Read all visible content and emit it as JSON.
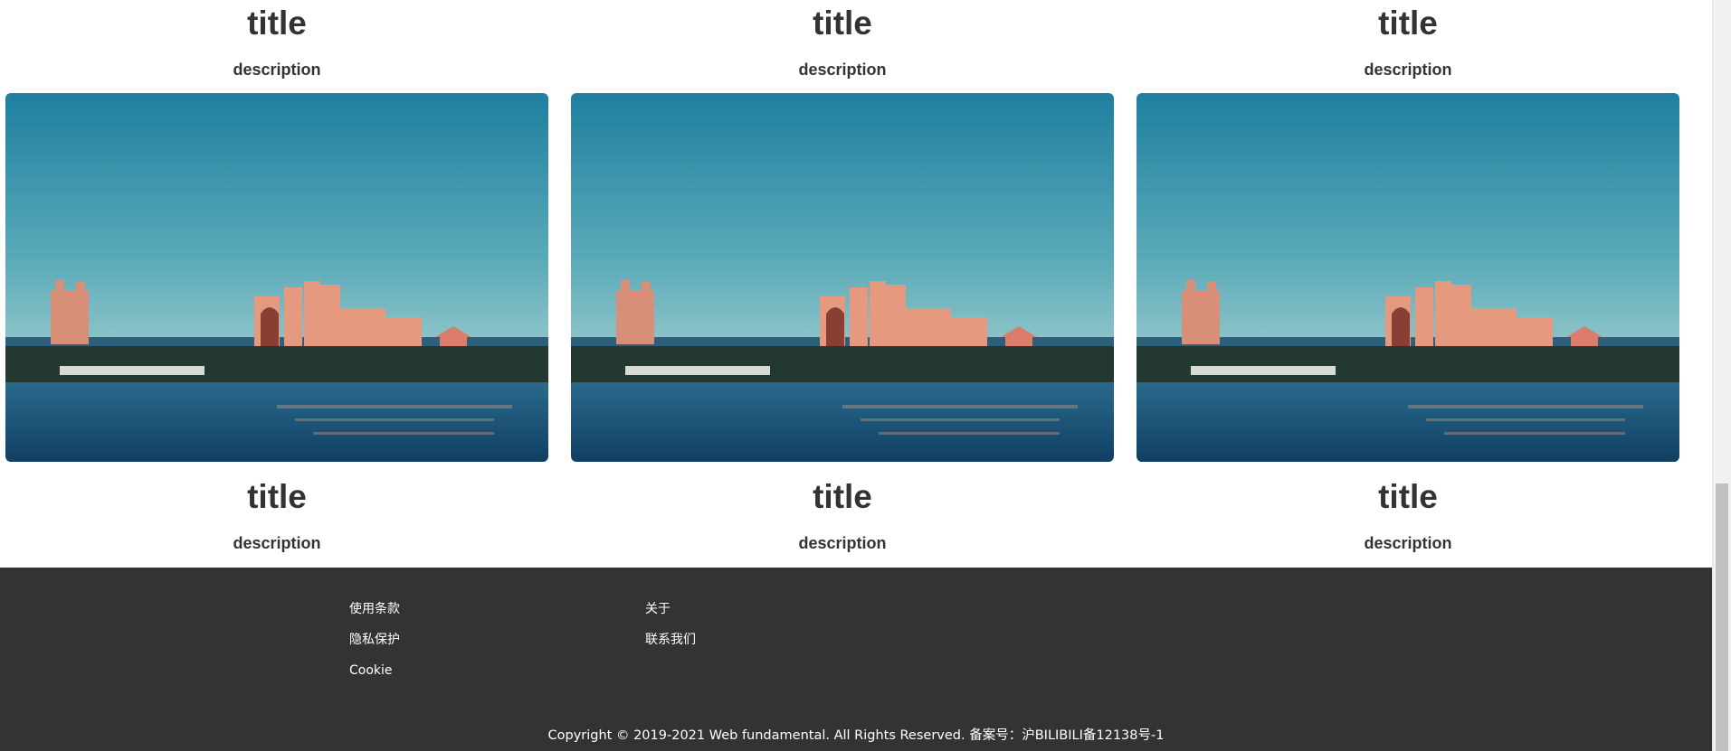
{
  "cards": [
    {
      "title": "title",
      "description": "description"
    },
    {
      "title": "title",
      "description": "description"
    },
    {
      "title": "title",
      "description": "description"
    }
  ],
  "cards_row2": [
    {
      "title": "title",
      "description": "description"
    },
    {
      "title": "title",
      "description": "description"
    },
    {
      "title": "title",
      "description": "description"
    }
  ],
  "footer": {
    "left_links": [
      "使用条款",
      "隐私保护",
      "Cookie"
    ],
    "right_links": [
      "关于",
      "联系我们"
    ],
    "copyright": "Copyright © 2019-2021 Web fundamental. All Rights Reserved. 备案号：沪BILIBILI备12138号-1",
    "background": "#333333"
  }
}
